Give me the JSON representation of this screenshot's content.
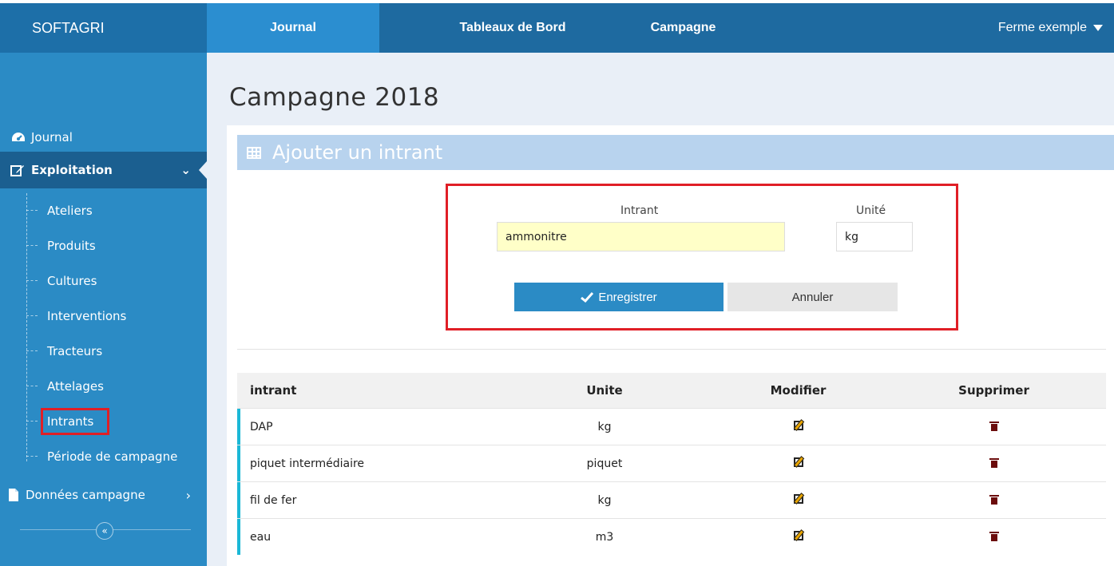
{
  "app": {
    "brand": "SOFTAGRI",
    "farm": "Ferme exemple"
  },
  "topnav": {
    "journal": "Journal",
    "tableaux": "Tableaux de Bord",
    "campagne": "Campagne"
  },
  "sidebar": {
    "journal": "Journal",
    "exploitation": "Exploitation",
    "items": [
      "Ateliers",
      "Produits",
      "Cultures",
      "Interventions",
      "Tracteurs",
      "Attelages",
      "Intrants",
      "Période de campagne"
    ],
    "donnees": "Données campagne",
    "collapse": "«"
  },
  "page": {
    "title": "Campagne 2018"
  },
  "form": {
    "header": "Ajouter un intrant",
    "intrant_label": "Intrant",
    "intrant_value": "ammonitre",
    "unite_label": "Unité",
    "unite_value": "kg",
    "save": "Enregistrer",
    "cancel": "Annuler"
  },
  "table": {
    "columns": [
      "intrant",
      "Unite",
      "Modifier",
      "Supprimer"
    ],
    "rows": [
      {
        "intrant": "DAP",
        "unite": "kg"
      },
      {
        "intrant": "piquet intermédiaire",
        "unite": "piquet"
      },
      {
        "intrant": "fil de fer",
        "unite": "kg"
      },
      {
        "intrant": "eau",
        "unite": "m3"
      }
    ]
  },
  "colors": {
    "primary": "#2b8bc5",
    "dark": "#1b5f90",
    "highlight": "#e01f26",
    "input_fill": "#ffffc8",
    "row_accent": "#1bb8d6"
  }
}
